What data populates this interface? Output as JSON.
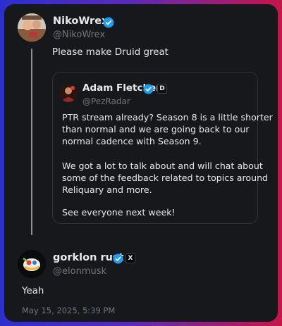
{
  "main_post": {
    "display_name": "NikoWrex",
    "handle": "@NikoWrex",
    "text": "Please make Druid great",
    "verified_icon": "verified-badge-icon"
  },
  "quoted_post": {
    "display_name": "Adam Fletcher",
    "handle": "@PezRadar",
    "affiliate_badge_text": "D",
    "paragraphs": [
      {
        "lines": [
          "PTR stream already? Season 8 is a little shorter",
          "than normal and we are going back to our",
          "normal cadence with Season 9."
        ]
      },
      {
        "lines": [
          "We got a lot to talk about and will chat about",
          "some of the feedback related to topics around",
          "Reliquary and more."
        ]
      },
      {
        "lines": [
          "See everyone next week!"
        ]
      }
    ]
  },
  "reply_post": {
    "display_name": "gorklon rust",
    "handle": "@elonmusk",
    "text": "Yeah",
    "affiliate_badge_text": "X",
    "timestamp": "May 15, 2025, 5:39 PM"
  },
  "colors": {
    "verified_blue": "#1d9bf0",
    "card_background": "#16181c",
    "secondary_text": "#71767b"
  }
}
